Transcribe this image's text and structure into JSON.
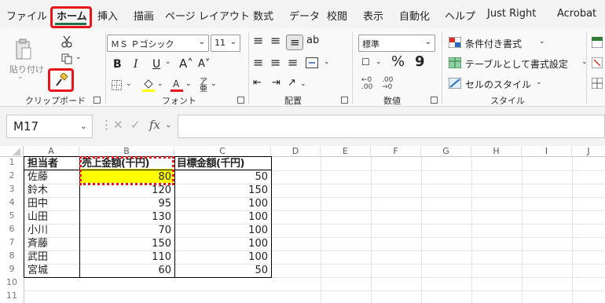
{
  "menu": {
    "tabs": [
      "ファイル",
      "ホーム",
      "挿入",
      "描画",
      "ページ レイアウト",
      "数式",
      "データ",
      "校閲",
      "表示",
      "自動化",
      "ヘルプ",
      "Just Right",
      "Acrobat"
    ]
  },
  "ribbon": {
    "clipboard": {
      "paste_label": "貼り付け",
      "group_label": "クリップボード"
    },
    "font": {
      "font_name": "ＭＳ Ｐゴシック",
      "font_size": "11",
      "group_label": "フォント",
      "bold": "B",
      "italic": "I",
      "underline": "U"
    },
    "alignment": {
      "group_label": "配置"
    },
    "number": {
      "format": "標準",
      "percent": "%",
      "comma": "9",
      "group_label": "数値"
    },
    "styles": {
      "conditional": "条件付き書式",
      "table": "テーブルとして書式設定",
      "cell_style": "セルのスタイル",
      "group_label": "スタイル"
    }
  },
  "formula_bar": {
    "name_box": "M17",
    "fx": "fx",
    "content": ""
  },
  "sheet": {
    "columns": [
      "A",
      "B",
      "C",
      "D",
      "E",
      "F",
      "G",
      "H",
      "I",
      "J"
    ],
    "rows": [
      "1",
      "2",
      "3",
      "4",
      "5",
      "6",
      "7",
      "8",
      "9",
      "10",
      "11"
    ],
    "headers": [
      "担当者",
      "売上金額(千円)",
      "目標金額(千円)"
    ],
    "data": [
      [
        "佐藤",
        "80",
        "50"
      ],
      [
        "鈴木",
        "120",
        "150"
      ],
      [
        "田中",
        "95",
        "100"
      ],
      [
        "山田",
        "130",
        "100"
      ],
      [
        "小川",
        "70",
        "100"
      ],
      [
        "斉藤",
        "150",
        "100"
      ],
      [
        "武田",
        "110",
        "100"
      ],
      [
        "宮城",
        "60",
        "50"
      ]
    ]
  },
  "colors": {
    "accent": "#1f7145",
    "highlight": "#ffff00",
    "annotation": "#e8141a"
  }
}
